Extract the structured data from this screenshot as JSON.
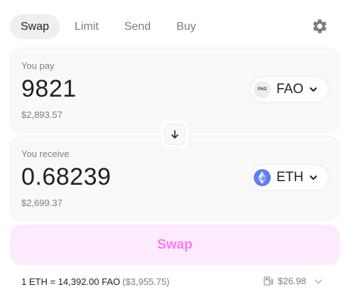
{
  "tabs": [
    {
      "label": "Swap",
      "active": true
    },
    {
      "label": "Limit",
      "active": false
    },
    {
      "label": "Send",
      "active": false
    },
    {
      "label": "Buy",
      "active": false
    }
  ],
  "settings_icon": "gear-icon",
  "pay": {
    "label": "You pay",
    "amount": "9821",
    "usd": "$2,893.57",
    "token": {
      "logo_text": "FAO",
      "symbol": "FAO",
      "icon": "fao-token-icon"
    }
  },
  "receive": {
    "label": "You receive",
    "amount": "0.68239",
    "usd": "$2,699.37",
    "token": {
      "symbol": "ETH",
      "icon": "eth-token-icon",
      "color": "#627eea"
    }
  },
  "switch_icon": "arrow-down-icon",
  "swap_button": {
    "label": "Swap",
    "bg": "#fdeafd",
    "color": "#f27ef6"
  },
  "rate": {
    "text": "1 ETH = 14,392.00 FAO",
    "usd": "($3,955.75)"
  },
  "gas": {
    "icon": "gas-pump-icon",
    "value": "$26.98"
  }
}
